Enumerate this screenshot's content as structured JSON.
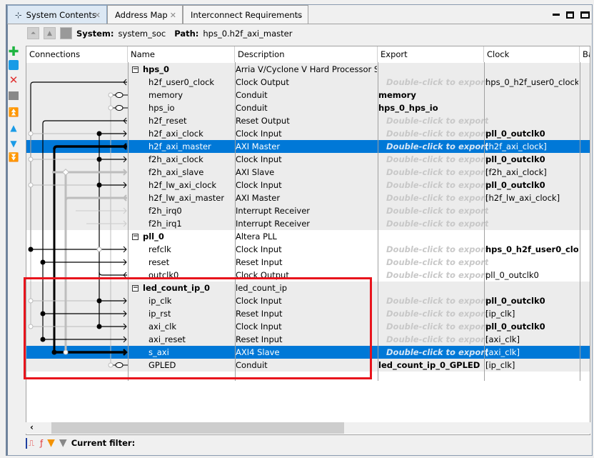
{
  "tabs": [
    {
      "label": "System Contents",
      "active": true
    },
    {
      "label": "Address Map"
    },
    {
      "label": "Interconnect Requirements"
    }
  ],
  "pathbar": {
    "system_label": "System:",
    "system_value": "system_soc",
    "path_label": "Path:",
    "path_value": "hps_0.h2f_axi_master"
  },
  "columns": [
    "Connections",
    "Name",
    "Description",
    "Export",
    "Clock",
    "Ba"
  ],
  "rows": [
    {
      "name": "hps_0",
      "desc": "Arria V/Cyclone V Hard Processor System",
      "export": "",
      "clock": "",
      "group": true,
      "bg": "g"
    },
    {
      "name": "h2f_user0_clock",
      "desc": "Clock Output",
      "export": "Double-click to export",
      "ph": true,
      "clock": "hps_0_h2f_user0_clock",
      "bg": "g"
    },
    {
      "name": "memory",
      "desc": "Conduit",
      "export": "memory",
      "clock": "",
      "bg": "g"
    },
    {
      "name": "hps_io",
      "desc": "Conduit",
      "export": "hps_0_hps_io",
      "clock": "",
      "bg": "g"
    },
    {
      "name": "h2f_reset",
      "desc": "Reset Output",
      "export": "Double-click to export",
      "ph": true,
      "clock": "",
      "bg": "g"
    },
    {
      "name": "h2f_axi_clock",
      "desc": "Clock Input",
      "export": "Double-click to export",
      "ph": true,
      "clock": "pll_0_outclk0",
      "cb": true,
      "bg": "g"
    },
    {
      "name": "h2f_axi_master",
      "desc": "AXI Master",
      "export": "Double-click to export",
      "ph": true,
      "clock": "[h2f_axi_clock]",
      "bg": "g",
      "selected": true
    },
    {
      "name": "f2h_axi_clock",
      "desc": "Clock Input",
      "export": "Double-click to export",
      "ph": true,
      "clock": "pll_0_outclk0",
      "cb": true,
      "bg": "g"
    },
    {
      "name": "f2h_axi_slave",
      "desc": "AXI Slave",
      "export": "Double-click to export",
      "ph": true,
      "clock": "[f2h_axi_clock]",
      "bg": "g"
    },
    {
      "name": "h2f_lw_axi_clock",
      "desc": "Clock Input",
      "export": "Double-click to export",
      "ph": true,
      "clock": "pll_0_outclk0",
      "cb": true,
      "bg": "g"
    },
    {
      "name": "h2f_lw_axi_master",
      "desc": "AXI Master",
      "export": "Double-click to export",
      "ph": true,
      "clock": "[h2f_lw_axi_clock]",
      "bg": "g"
    },
    {
      "name": "f2h_irq0",
      "desc": "Interrupt Receiver",
      "export": "Double-click to export",
      "ph": true,
      "clock": "",
      "bg": "g"
    },
    {
      "name": "f2h_irq1",
      "desc": "Interrupt Receiver",
      "export": "Double-click to export",
      "ph": true,
      "clock": "",
      "bg": "g"
    },
    {
      "name": "pll_0",
      "desc": "Altera PLL",
      "export": "",
      "clock": "",
      "group": true,
      "bg": "w"
    },
    {
      "name": "refclk",
      "desc": "Clock Input",
      "export": "Double-click to export",
      "ph": true,
      "clock": "hps_0_h2f_user0_clo...",
      "cb": true,
      "bg": "w"
    },
    {
      "name": "reset",
      "desc": "Reset Input",
      "export": "Double-click to export",
      "ph": true,
      "clock": "",
      "bg": "w"
    },
    {
      "name": "outclk0",
      "desc": "Clock Output",
      "export": "Double-click to export",
      "ph": true,
      "clock": "pll_0_outclk0",
      "bg": "w"
    },
    {
      "name": "led_count_ip_0",
      "desc": "led_count_ip",
      "export": "",
      "clock": "",
      "group": true,
      "bg": "g"
    },
    {
      "name": "ip_clk",
      "desc": "Clock Input",
      "export": "Double-click to export",
      "ph": true,
      "clock": "pll_0_outclk0",
      "cb": true,
      "bg": "g"
    },
    {
      "name": "ip_rst",
      "desc": "Reset Input",
      "export": "Double-click to export",
      "ph": true,
      "clock": "[ip_clk]",
      "bg": "g"
    },
    {
      "name": "axi_clk",
      "desc": "Clock Input",
      "export": "Double-click to export",
      "ph": true,
      "clock": "pll_0_outclk0",
      "cb": true,
      "bg": "g"
    },
    {
      "name": "axi_reset",
      "desc": "Reset Input",
      "export": "Double-click to export",
      "ph": true,
      "clock": "[axi_clk]",
      "bg": "g"
    },
    {
      "name": "s_axi",
      "desc": "AXI4 Slave",
      "export": "Double-click to export",
      "ph": true,
      "clock": "[axi_clk]",
      "bg": "g",
      "selected": true
    },
    {
      "name": "GPLED",
      "desc": "Conduit",
      "export": "led_count_ip_0_GPLED",
      "clock": "[ip_clk]",
      "bg": "g"
    }
  ],
  "filter": {
    "label": "Current filter:"
  },
  "colors": {
    "selection": "#0078d7",
    "highlight": "#e8141c",
    "add": "#1db440",
    "arrows": "#1a9be6"
  }
}
